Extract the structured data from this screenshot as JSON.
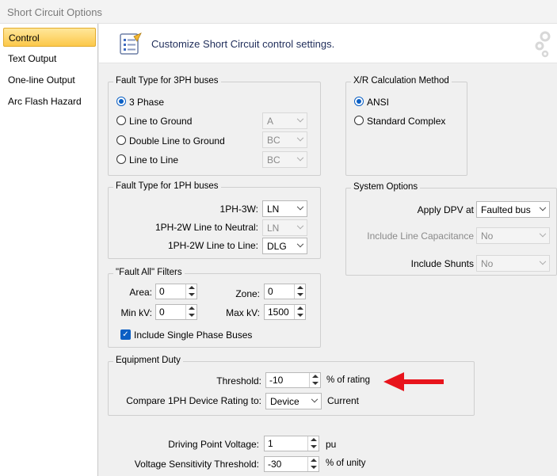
{
  "window": {
    "title": "Short Circuit Options"
  },
  "sidebar": {
    "items": [
      {
        "label": "Control",
        "active": true
      },
      {
        "label": "Text Output"
      },
      {
        "label": "One-line Output"
      },
      {
        "label": "Arc Flash Hazard"
      }
    ]
  },
  "header": {
    "text": "Customize Short Circuit control settings.",
    "icon": "settings-list-icon"
  },
  "fault3ph": {
    "legend": "Fault Type for 3PH buses",
    "options": [
      {
        "label": "3 Phase",
        "selected": true
      },
      {
        "label": "Line to Ground",
        "combo": "A"
      },
      {
        "label": "Double Line to Ground",
        "combo": "BC"
      },
      {
        "label": "Line to Line",
        "combo": "BC"
      }
    ]
  },
  "xr": {
    "legend": "X/R Calculation Method",
    "options": [
      {
        "label": "ANSI",
        "selected": true
      },
      {
        "label": "Standard Complex"
      }
    ]
  },
  "fault1ph": {
    "legend": "Fault Type for 1PH buses",
    "rows": [
      {
        "label": "1PH-3W:",
        "value": "LN",
        "enabled": true
      },
      {
        "label": "1PH-2W Line to Neutral:",
        "value": "LN",
        "enabled": false
      },
      {
        "label": "1PH-2W Line to Line:",
        "value": "DLG",
        "enabled": true
      }
    ]
  },
  "system": {
    "legend": "System Options",
    "rows": [
      {
        "label": "Apply DPV at",
        "value": "Faulted bus",
        "enabled": true
      },
      {
        "label": "Include Line Capacitance",
        "value": "No",
        "enabled": false
      },
      {
        "label": "Include Shunts",
        "value": "No",
        "enabled": false
      }
    ]
  },
  "filters": {
    "legend": "\"Fault All\" Filters",
    "area_label": "Area:",
    "area": "0",
    "zone_label": "Zone:",
    "zone": "0",
    "minkv_label": "Min kV:",
    "minkv": "0",
    "maxkv_label": "Max kV:",
    "maxkv": "1500",
    "include_label": "Include Single Phase Buses",
    "include_checked": true
  },
  "duty": {
    "legend": "Equipment Duty",
    "threshold_label": "Threshold:",
    "threshold": "-10",
    "threshold_unit": "% of rating",
    "compare_label": "Compare 1PH Device Rating to:",
    "compare_value": "Device",
    "compare_unit": "Current"
  },
  "bottom": {
    "dpv_label": "Driving Point Voltage:",
    "dpv": "1",
    "dpv_unit": "pu",
    "vst_label": "Voltage Sensitivity Threshold:",
    "vst": "-30",
    "vst_unit": "% of unity"
  },
  "colors": {
    "accent": "#0b5fc4",
    "arrow": "#e8141c",
    "active_nav": "#fcc84a"
  }
}
